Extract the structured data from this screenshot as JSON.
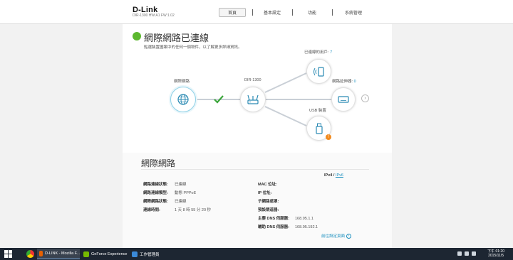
{
  "header": {
    "logo": "D-Link",
    "model_info": "DIR-1300 HW:A1 FW:1.02",
    "nav": [
      "首頁",
      "基本設定",
      "功能",
      "系統管理"
    ]
  },
  "status": {
    "title": "網際網路已連線",
    "subtitle": "點選裝置圖案中的任何一個物件，以了解更多詳細資訊。"
  },
  "topology": {
    "internet_label": "網際網路",
    "router_label": "DIR-1300",
    "clients_label": "已連線的用戶:",
    "clients_count": "7",
    "extender_label": "網路延伸器:",
    "extender_count": "0",
    "usb_label": "USB 裝置"
  },
  "internet_section": {
    "title": "網際網路",
    "ipv4": "IPv4",
    "ipv6": "IPv6",
    "separator": "/",
    "left_rows": [
      {
        "key": "網路連線狀態:",
        "value": "已連線"
      },
      {
        "key": "網路連線類型:",
        "value": "動態 PPPoE"
      },
      {
        "key": "網際網路狀態:",
        "value": "已連線"
      },
      {
        "key": "連線時間:",
        "value": "1 天 8 時 55 分 20 秒"
      }
    ],
    "right_rows": [
      {
        "key": "MAC 位址:",
        "value": ""
      },
      {
        "key": "IP 位址:",
        "value": ""
      },
      {
        "key": "子網路遮罩:",
        "value": ""
      },
      {
        "key": "預設閘道器:",
        "value": ""
      },
      {
        "key": "主要 DNS 伺服器:",
        "value": "168.95.1.1"
      },
      {
        "key": "輔助 DNS 伺服器:",
        "value": "168.95.192.1"
      }
    ],
    "more_link": "前往設定頁面"
  },
  "taskbar": {
    "tasks": [
      "D-LINK - Mozilla F...",
      "GeForce Experience",
      "工作管理員"
    ],
    "time": "下午 01:20",
    "date": "2015/11/5"
  },
  "colors": {
    "connected_green": "#5cb82f",
    "link_blue": "#1a8fbf",
    "check_green": "#3aa53a",
    "alert_orange": "#f28a1c"
  }
}
